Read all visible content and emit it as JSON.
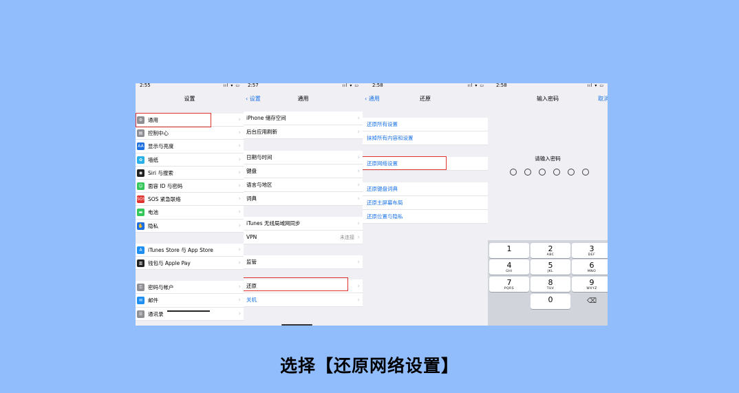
{
  "screen1": {
    "time": "2:55",
    "indicators": "ııl ▾ ▭",
    "title": "设置",
    "groups": [
      [
        {
          "label": "通用",
          "icon": "general-icon",
          "color": "#8e8e93",
          "glyph": "⚙"
        },
        {
          "label": "控制中心",
          "icon": "control-center-icon",
          "color": "#8e8e93",
          "glyph": "▤"
        },
        {
          "label": "显示与亮度",
          "icon": "display-brightness-icon",
          "color": "#1e6fe0",
          "glyph": "AA"
        },
        {
          "label": "墙纸",
          "icon": "wallpaper-icon",
          "color": "#2ab0e6",
          "glyph": "✿"
        },
        {
          "label": "Siri 与搜索",
          "icon": "siri-icon",
          "color": "#222",
          "glyph": "◉"
        },
        {
          "label": "面容 ID 与密码",
          "icon": "face-id-icon",
          "color": "#34c759",
          "glyph": "☺"
        },
        {
          "label": "SOS 紧急联络",
          "icon": "sos-icon",
          "color": "#e0332f",
          "glyph": "SOS"
        },
        {
          "label": "电池",
          "icon": "battery-icon",
          "color": "#34c759",
          "glyph": "▬"
        },
        {
          "label": "隐私",
          "icon": "privacy-icon",
          "color": "#1e6fe0",
          "glyph": "✋"
        }
      ],
      [
        {
          "label": "iTunes Store 与 App Store",
          "icon": "app-store-icon",
          "color": "#1e8ef0",
          "glyph": "A"
        },
        {
          "label": "钱包与 Apple Pay",
          "icon": "wallet-icon",
          "color": "#222",
          "glyph": "▥"
        }
      ],
      [
        {
          "label": "密码与帐户",
          "icon": "passwords-accounts-icon",
          "color": "#8e8e93",
          "glyph": "⚿"
        },
        {
          "label": "邮件",
          "icon": "mail-icon",
          "color": "#1e8ef0",
          "glyph": "✉"
        },
        {
          "label": "通讯录",
          "icon": "contacts-icon",
          "color": "#8e8e93",
          "glyph": "☰"
        }
      ]
    ]
  },
  "screen2": {
    "time": "2:57",
    "indicators": "ııl ▾ ▭",
    "back": "设置",
    "title": "通用",
    "groups": [
      [
        {
          "label": "iPhone 储存空间"
        },
        {
          "label": "后台应用刷新"
        }
      ],
      [
        {
          "label": "日期与时间"
        },
        {
          "label": "键盘"
        },
        {
          "label": "语言与地区"
        },
        {
          "label": "词典"
        }
      ],
      [
        {
          "label": "iTunes 无线局域网同步"
        },
        {
          "label": "VPN",
          "value": "未连接"
        }
      ],
      [
        {
          "label": "监管"
        }
      ],
      [
        {
          "label": "还原"
        },
        {
          "label": "关机",
          "blue": true
        }
      ]
    ]
  },
  "screen3": {
    "time": "2:58",
    "indicators": "ııl ▾ ▭",
    "back": "通用",
    "title": "还原",
    "groups": [
      [
        {
          "label": "还原所有设置"
        },
        {
          "label": "抹掉所有内容和设置"
        }
      ],
      [
        {
          "label": "还原网络设置"
        }
      ],
      [
        {
          "label": "还原键盘词典"
        },
        {
          "label": "还原主屏幕布局"
        },
        {
          "label": "还原位置与隐私"
        }
      ]
    ]
  },
  "screen4": {
    "time": "2:58",
    "indicators": "ııl ▾ ▭",
    "title": "输入密码",
    "cancel": "取消",
    "prompt": "请输入密码",
    "dots": 6,
    "keys": [
      {
        "digit": "1",
        "letters": ""
      },
      {
        "digit": "2",
        "letters": "ABC"
      },
      {
        "digit": "3",
        "letters": "DEF"
      },
      {
        "digit": "4",
        "letters": "GHI"
      },
      {
        "digit": "5",
        "letters": "JKL"
      },
      {
        "digit": "6",
        "letters": "MNO"
      },
      {
        "digit": "7",
        "letters": "PQRS"
      },
      {
        "digit": "8",
        "letters": "TUV"
      },
      {
        "digit": "9",
        "letters": "WXYZ"
      },
      {
        "digit": "0",
        "letters": ""
      }
    ],
    "delete_glyph": "⌫"
  },
  "caption": "选择【还原网络设置】"
}
